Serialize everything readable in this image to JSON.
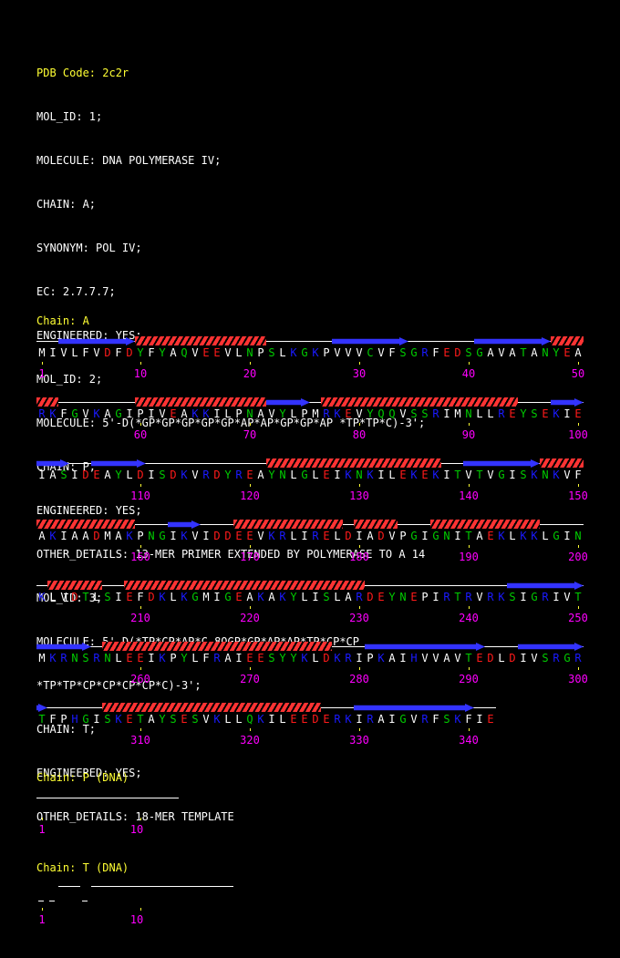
{
  "header": {
    "pdb_code": "PDB Code: 2c2r",
    "lines": [
      "MOL_ID: 1;",
      "MOLECULE: DNA POLYMERASE IV;",
      "CHAIN: A;",
      "SYNONYM: POL IV;",
      "EC: 2.7.7.7;",
      "ENGINEERED: YES;",
      "MOL_ID: 2;",
      "MOLECULE: 5'-D(*GP*GP*GP*GP*GP*AP*AP*GP*GP*AP *TP*TP*C)-3';",
      "CHAIN: P;",
      "ENGINEERED: YES;",
      "OTHER_DETAILS: 13-MER PRIMER EXTENDED BY POLYMERASE TO A 14",
      "MOL_ID: 3;",
      "MOLECULE: 5'-D(*TP*CP*AP*C 8OGP*GP*AP*AP*TP*CP*CP",
      "*TP*TP*CP*CP*CP*CP*C)-3';",
      "CHAIN: T;",
      "ENGINEERED: YES;",
      "OTHER_DETAILS: 18-MER TEMPLATE"
    ]
  },
  "chain_a": {
    "title": "Chain: A",
    "sequence": "MIVLFVDFDYFYAQVEEVLNPSLKGKPVVVCVFSGRFEDSGAVATANYEARKFGVKAGIPIVEAKKILPNAVYLPMRKEVYQQVSSRIMNLLREYSEKIEIASIDEAYLDISDKVRDYREAYNLGLEIKNKILEKEKITVTVGISKNKVFAKIAADMAKPNGIKVIDDEEVKRLIRELDIADVPGIGNITAEKLKKLGINKLVDTLSIEFDKLKGMIGEAKAKYLISLARDEYNEPIRTRVRKSIGRIVTMKRNSRNLEEIKPYLFRAIEESYYKLDKRIPKAIHVVAVTEDLDIVSRGRTFPHGISKETAYSESVKLLQKILEEDERKIRAIGVRFSKFIE",
    "numbers": [
      "1",
      "10",
      "20",
      "30",
      "40",
      "50",
      "60",
      "70",
      "80",
      "90",
      "100",
      "110",
      "120",
      "130",
      "140",
      "150",
      "160",
      "170",
      "180",
      "190",
      "200",
      "210",
      "220",
      "230",
      "240",
      "250",
      "260",
      "270",
      "280",
      "290",
      "300",
      "310",
      "320",
      "330",
      "340"
    ],
    "secondary_structure": [
      {
        "type": "strand",
        "start": 3,
        "end": 9
      },
      {
        "type": "helix",
        "start": 10,
        "end": 21
      },
      {
        "type": "strand",
        "start": 28,
        "end": 34
      },
      {
        "type": "strand",
        "start": 41,
        "end": 47
      },
      {
        "type": "helix",
        "start": 48,
        "end": 52
      },
      {
        "type": "helix",
        "start": 60,
        "end": 71
      },
      {
        "type": "strand",
        "start": 72,
        "end": 75
      },
      {
        "type": "helix",
        "start": 77,
        "end": 94
      },
      {
        "type": "strand",
        "start": 98,
        "end": 100
      },
      {
        "type": "strand",
        "start": 101,
        "end": 103
      },
      {
        "type": "strand",
        "start": 106,
        "end": 110
      },
      {
        "type": "helix",
        "start": 122,
        "end": 137
      },
      {
        "type": "strand",
        "start": 140,
        "end": 146
      },
      {
        "type": "helix",
        "start": 147,
        "end": 159
      },
      {
        "type": "strand",
        "start": 163,
        "end": 165
      },
      {
        "type": "helix",
        "start": 169,
        "end": 178
      },
      {
        "type": "helix",
        "start": 180,
        "end": 183
      },
      {
        "type": "helix",
        "start": 187,
        "end": 196
      },
      {
        "type": "helix",
        "start": 202,
        "end": 206
      },
      {
        "type": "helix",
        "start": 209,
        "end": 230
      },
      {
        "type": "strand",
        "start": 244,
        "end": 250
      },
      {
        "type": "strand",
        "start": 251,
        "end": 255
      },
      {
        "type": "helix",
        "start": 257,
        "end": 277
      },
      {
        "type": "strand",
        "start": 281,
        "end": 291
      },
      {
        "type": "strand",
        "start": 295,
        "end": 300
      },
      {
        "type": "strand",
        "start": 301,
        "end": 301
      },
      {
        "type": "helix",
        "start": 307,
        "end": 326
      },
      {
        "type": "strand",
        "start": 330,
        "end": 340
      }
    ],
    "colors": {
      "hydrophobic": "#ffffff",
      "positive": "#1a1aff",
      "negative": "#ff1a1a",
      "polar": "#00cc00",
      "helix": "#ff3333",
      "strand": "#3333ff",
      "number": "#ff00ff",
      "tick": "#ffff33",
      "title": "#ffff33"
    }
  },
  "chain_p": {
    "title": "Chain: P (DNA)",
    "numbers": [
      "1",
      "10"
    ]
  },
  "chain_t": {
    "title": "Chain: T (DNA)",
    "numbers": [
      "1",
      "10"
    ]
  }
}
